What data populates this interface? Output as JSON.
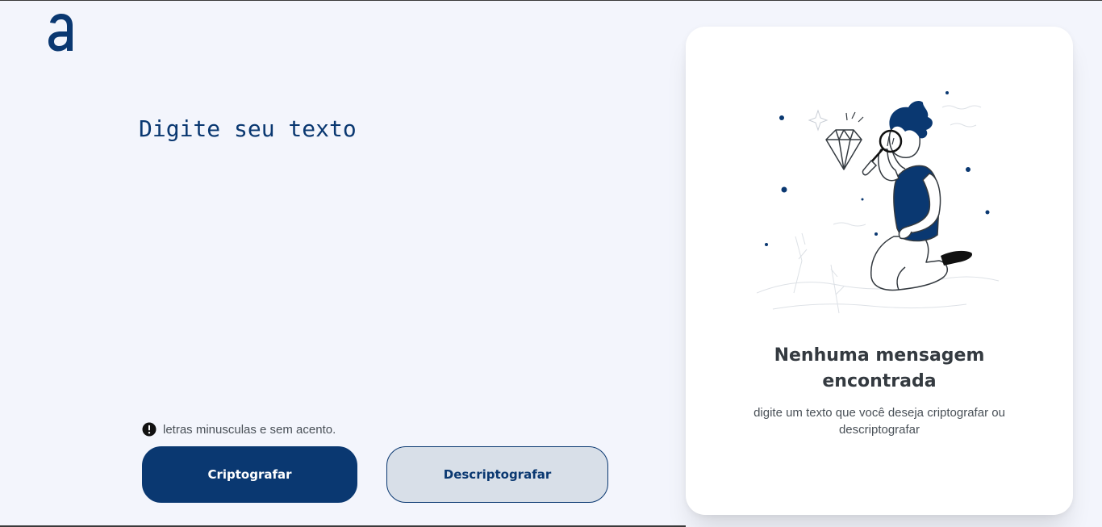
{
  "logo": {
    "icon": "alura-logo-icon",
    "color": "#0a3871"
  },
  "input": {
    "placeholder": "Digite seu texto",
    "value": ""
  },
  "hint": {
    "icon": "exclamation-circle-icon",
    "text": "letras minusculas e sem acento."
  },
  "buttons": {
    "encrypt_label": "Criptografar",
    "decrypt_label": "Descriptografar"
  },
  "output": {
    "illustration": "person-with-magnifier-illustration",
    "title": "Nenhuma mensagem encontrada",
    "subtitle": "digite um texto que você deseja criptografar ou descriptografar"
  },
  "colors": {
    "background": "#f3f5fc",
    "primary": "#0a3871",
    "secondary": "#d8dfe8",
    "card": "#ffffff",
    "text_dark": "#343a40",
    "text_muted": "#495057"
  }
}
